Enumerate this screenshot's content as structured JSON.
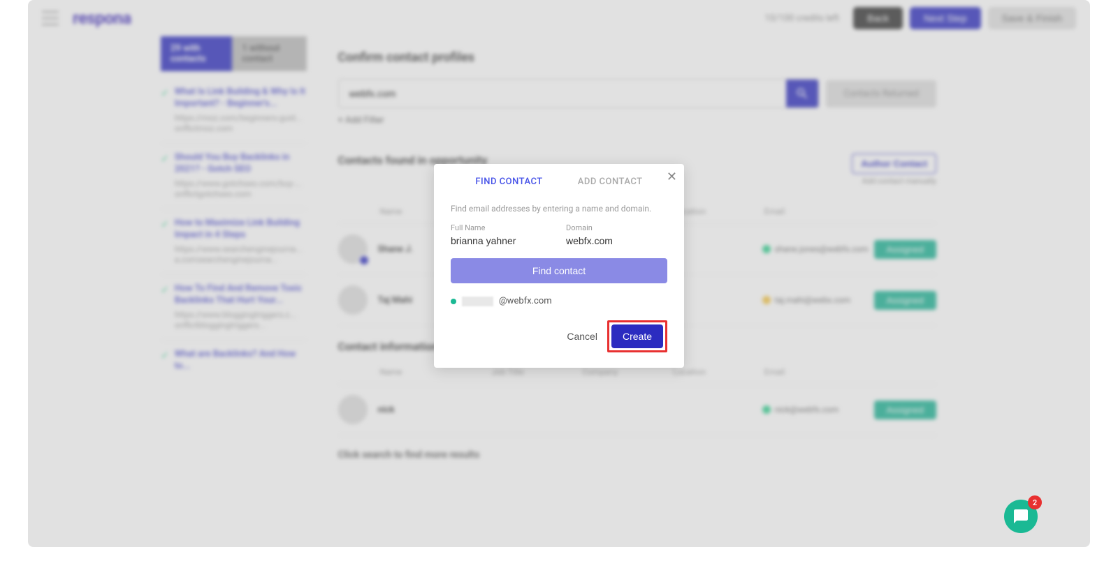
{
  "header": {
    "logo": "respona",
    "credits": "10/100 credits left",
    "back_btn": "Back",
    "next_btn": "Next Step",
    "save_btn": "Save & Finish"
  },
  "sidebar": {
    "tab_active": "29 with contacts",
    "tab_inactive": "1 without contact",
    "items": [
      {
        "title": "What Is Link Building & Why Is It Important? - Beginner's...",
        "url": "https://moz.com/beginners-guid... onflictmoz.com"
      },
      {
        "title": "Should You Buy Backlinks in 2021? - Gotch SEO",
        "url": "https://www.gotchseo.com/buy-... onflictgotchseo.com"
      },
      {
        "title": "How to Maximize Link Building Impact in 4 Steps",
        "url": "https://www.searchenginejourna... a.comsearchenginejourna..."
      },
      {
        "title": "How To Find And Remove Toxic Backlinks That Hurt Your...",
        "url": "https://www.bloggingtriggers.c... onflictbloggingtriggers..."
      },
      {
        "title": "What are Backlinks? And How to..."
      }
    ]
  },
  "main": {
    "title": "Confirm contact profiles",
    "search_value": "webfx.com",
    "contacts_btn": "Contacts Returned",
    "add_filter": "+ Add Filter",
    "section1_title": "Contacts found in opportunity",
    "author_btn": "Author Contact",
    "add_manual": "Add contact manually",
    "cols": {
      "name": "Name",
      "job": "Job Title",
      "company": "Company",
      "location": "Location",
      "email": "Email"
    },
    "rows": [
      {
        "name": "Shane J.",
        "email": "shane.jones@webfx.com",
        "dot": "green",
        "assigned": "Assigned"
      },
      {
        "name": "Taj Mahi",
        "email": "taj.mahi@webx.com",
        "dot": "yellow",
        "assigned": "Assigned"
      }
    ],
    "section2_title": "Contact information",
    "rows2": [
      {
        "name": "nick",
        "email": "nick@webfx.com",
        "dot": "green",
        "assigned": "Assigned"
      }
    ],
    "footer": "Click search to find more results"
  },
  "modal": {
    "tab1": "FIND CONTACT",
    "tab2": "ADD CONTACT",
    "desc": "Find email addresses by entering a name and domain.",
    "fullname_label": "Full Name",
    "fullname_value": "brianna yahner",
    "domain_label": "Domain",
    "domain_value": "webfx.com",
    "find_btn": "Find contact",
    "result_email": "@webfx.com",
    "cancel_btn": "Cancel",
    "create_btn": "Create"
  },
  "chat": {
    "badge": "2"
  }
}
